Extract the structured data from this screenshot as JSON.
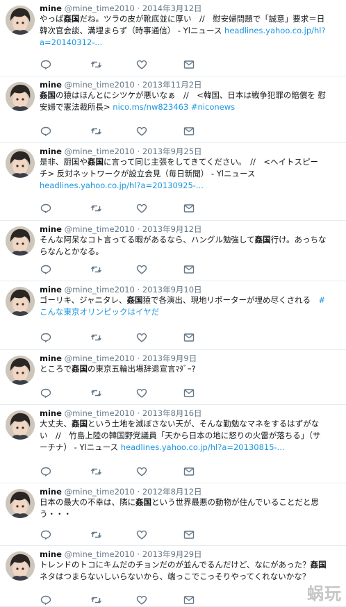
{
  "tweets": [
    {
      "name": "mine",
      "handle": "@mine_time2010",
      "sep": "·",
      "date": "2014年3月12日",
      "lines": [
        [
          {
            "t": "やっぱ"
          },
          {
            "t": "姦国",
            "b": true
          },
          {
            "t": "だね。ツラの皮が靴底並に厚い　//　慰安婦問題で「誠意」要求＝日"
          }
        ],
        [
          {
            "t": "韓次官会談、溝埋まらず（時事通信） - Ylニュース "
          },
          {
            "t": "headlines.yahoo.co.jp/hl?",
            "link": true
          }
        ],
        [
          {
            "t": "a=20140312-...",
            "link": true
          }
        ]
      ]
    },
    {
      "name": "mine",
      "handle": "@mine_time2010",
      "sep": "·",
      "date": "2013年11月2日",
      "lines": [
        [
          {
            "t": "姦国",
            "b": true
          },
          {
            "t": "の猿はほんとにシツケが悪いなぁ　//　<韓国、日本は戦争犯罪の賠償を 慰"
          }
        ],
        [
          {
            "t": "安婦で憲法裁所長> "
          },
          {
            "t": "nico.ms/nw823463 #niconews",
            "link": true
          }
        ]
      ]
    },
    {
      "name": "mine",
      "handle": "@mine_time2010",
      "sep": "·",
      "date": "2013年9月25日",
      "lines": [
        [
          {
            "t": "是非、厨国や"
          },
          {
            "t": "姦国",
            "b": true
          },
          {
            "t": "に言って同じ主張をしてきてください。　//　<ヘイトスピー"
          }
        ],
        [
          {
            "t": "チ> 反対ネットワークが設立会見（毎日新聞） - Ylニュース"
          }
        ],
        [
          {
            "t": "headlines.yahoo.co.jp/hl?a=20130925-...",
            "link": true
          }
        ]
      ]
    },
    {
      "name": "mine",
      "handle": "@mine_time2010",
      "sep": "·",
      "date": "2013年9月12日",
      "lines": [
        [
          {
            "t": "そんな阿呆なコト言ってる暇があるなら、ハングル勉強して"
          },
          {
            "t": "姦国",
            "b": true
          },
          {
            "t": "行け。あっちな"
          }
        ],
        [
          {
            "t": "らなんとかなる。"
          }
        ]
      ]
    },
    {
      "name": "mine",
      "handle": "@mine_time2010",
      "sep": "·",
      "date": "2013年9月10日",
      "lines": [
        [
          {
            "t": "ゴーリキ、ジャニタレ、"
          },
          {
            "t": "姦国",
            "b": true
          },
          {
            "t": "猿で各演出、現地リポーターが埋め尽くされる　"
          },
          {
            "t": "#",
            "link": true
          }
        ],
        [
          {
            "t": "こんな東京オリンピックはイヤだ",
            "link": true
          }
        ]
      ]
    },
    {
      "name": "mine",
      "handle": "@mine_time2010",
      "sep": "·",
      "date": "2013年9月9日",
      "lines": [
        [
          {
            "t": "ところで"
          },
          {
            "t": "姦国",
            "b": true
          },
          {
            "t": "の東京五輪出場辞退宣言ﾏﾀﾞｰ?"
          }
        ]
      ]
    },
    {
      "name": "mine",
      "handle": "@mine_time2010",
      "sep": "·",
      "date": "2013年8月16日",
      "lines": [
        [
          {
            "t": "大丈夫、"
          },
          {
            "t": "姦国",
            "b": true
          },
          {
            "t": "という土地を滅ぼさない天が、そんな勤勉なマネをするはずがな"
          }
        ],
        [
          {
            "t": "い　//　竹島上陸の韓国野党議員「天から日本の地に怒りの火雷が落ちる」（サ"
          }
        ],
        [
          {
            "t": "ーチナ） - Ylニュース "
          },
          {
            "t": "headlines.yahoo.co.jp/hl?a=20130815-...",
            "link": true
          }
        ]
      ]
    },
    {
      "name": "mine",
      "handle": "@mine_time2010",
      "sep": "·",
      "date": "2012年8月12日",
      "lines": [
        [
          {
            "t": "日本の最大の不幸は、隣に"
          },
          {
            "t": "姦国",
            "b": true
          },
          {
            "t": "という世界最悪の動物が住んでいることだと思"
          }
        ],
        [
          {
            "t": "う・・・"
          }
        ]
      ]
    },
    {
      "name": "mine",
      "handle": "@mine_time2010",
      "sep": "·",
      "date": "2013年9月29日",
      "lines": [
        [
          {
            "t": "トレンドのトコにキムだのチョンだのが並んでるんだけど、なにがあった？"
          },
          {
            "t": "姦国",
            "b": true
          }
        ],
        [
          {
            "t": "ネタはつまらないしいらないから、端っこでこっそりやってくれないかな？"
          }
        ]
      ]
    }
  ],
  "watermark": "蜗玩",
  "colors": {
    "link": "#1b95e0",
    "meta": "#657786",
    "divider": "#e6ecf0"
  },
  "icons": [
    "reply-icon",
    "retweet-icon",
    "like-icon",
    "message-icon"
  ]
}
